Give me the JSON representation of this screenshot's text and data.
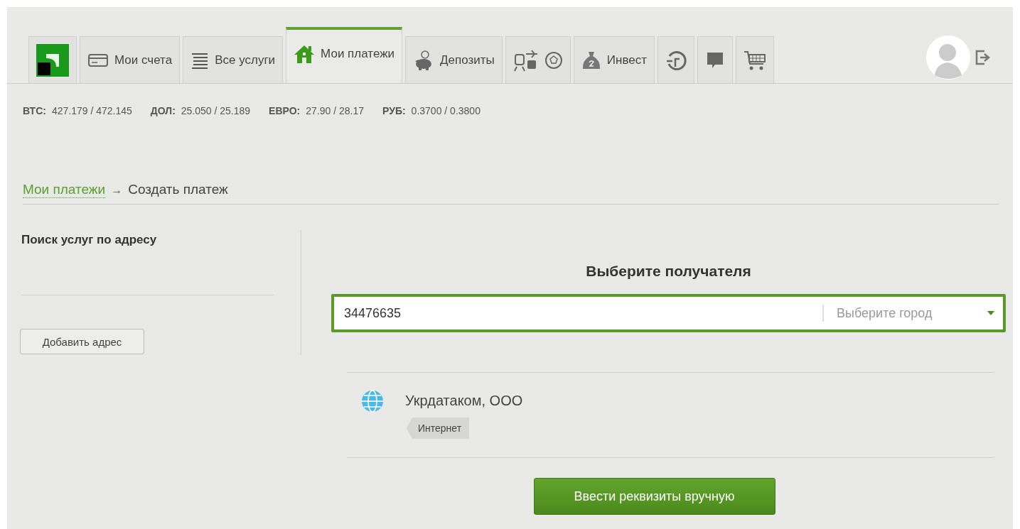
{
  "tabs": [
    {
      "kind": "logo",
      "selected": false
    },
    {
      "kind": "label",
      "label": "Мои счета",
      "selected": false
    },
    {
      "kind": "label",
      "label": "Все услуги",
      "selected": false
    },
    {
      "kind": "label",
      "label": "Мои платежи",
      "selected": true
    },
    {
      "kind": "label",
      "label": "Депозиты",
      "selected": false
    },
    {
      "kind": "icons",
      "selected": false
    },
    {
      "kind": "label",
      "label": "Инвест",
      "selected": false
    },
    {
      "kind": "icons",
      "selected": false
    },
    {
      "kind": "icons",
      "selected": false
    },
    {
      "kind": "icons",
      "selected": false
    }
  ],
  "rates": [
    {
      "code": "ВТС:",
      "value": "427.179 / 472.145"
    },
    {
      "code": "ДОЛ:",
      "value": "25.050 / 25.189"
    },
    {
      "code": "ЕВРО:",
      "value": "27.90 / 28.17"
    },
    {
      "code": "РУБ:",
      "value": "0.3700 / 0.3800"
    }
  ],
  "breadcrumb": {
    "link": "Мои платежи",
    "separator": "→",
    "current": "Создать платеж"
  },
  "sidebar": {
    "title": "Поиск услуг по адресу",
    "button": "Добавить адрес"
  },
  "main": {
    "heading": "Выберите получателя",
    "search_value": "34476635",
    "city_placeholder": "Выберите город",
    "results": [
      {
        "name": "Укрдатаком, ООО",
        "tag": "Интернет"
      }
    ],
    "button": "Ввести реквизиты вручную"
  }
}
